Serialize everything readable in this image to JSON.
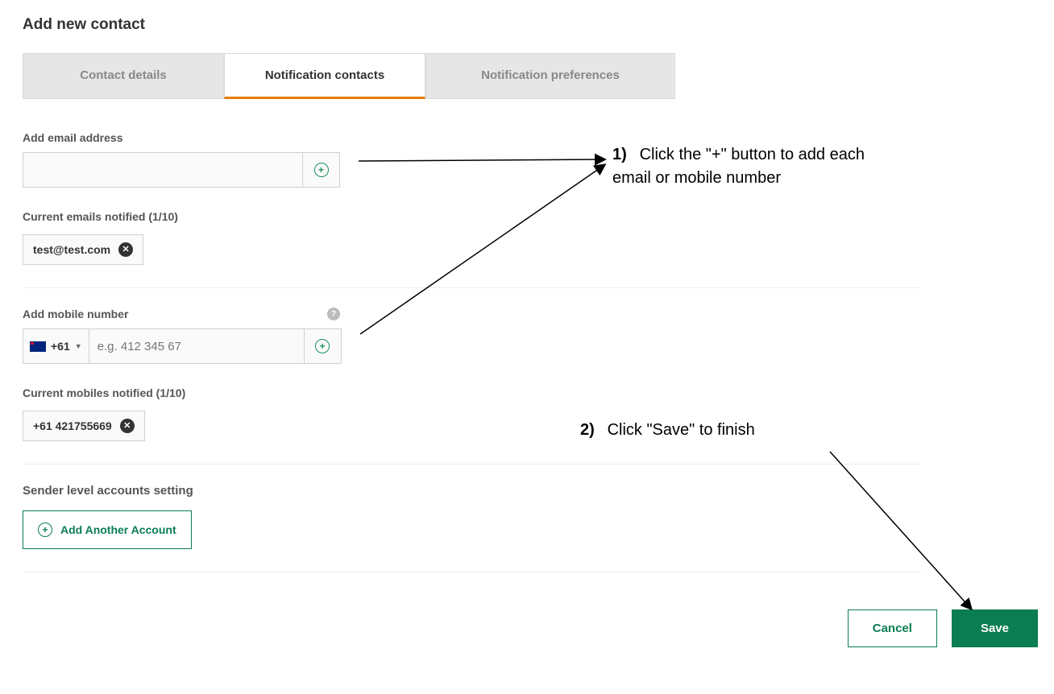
{
  "title": "Add new contact",
  "tabs": {
    "contact_details": "Contact details",
    "notification_contacts": "Notification contacts",
    "notification_preferences": "Notification preferences"
  },
  "email": {
    "label": "Add email address",
    "value": "",
    "current_label": "Current emails notified (1/10)",
    "items": [
      "test@test.com"
    ]
  },
  "mobile": {
    "label": "Add mobile number",
    "dial_code": "+61",
    "placeholder": "e.g. 412 345 67",
    "current_label": "Current mobiles notified (1/10)",
    "items": [
      "+61 421755669"
    ]
  },
  "sender_section": {
    "title": "Sender level accounts setting",
    "add_button": "Add Another Account"
  },
  "actions": {
    "cancel": "Cancel",
    "save": "Save"
  },
  "annotations": {
    "step1_num": "1)",
    "step1_text": "Click the \"+\" button to add each email or mobile number",
    "step2_num": "2)",
    "step2_text": "Click \"Save\" to finish"
  }
}
